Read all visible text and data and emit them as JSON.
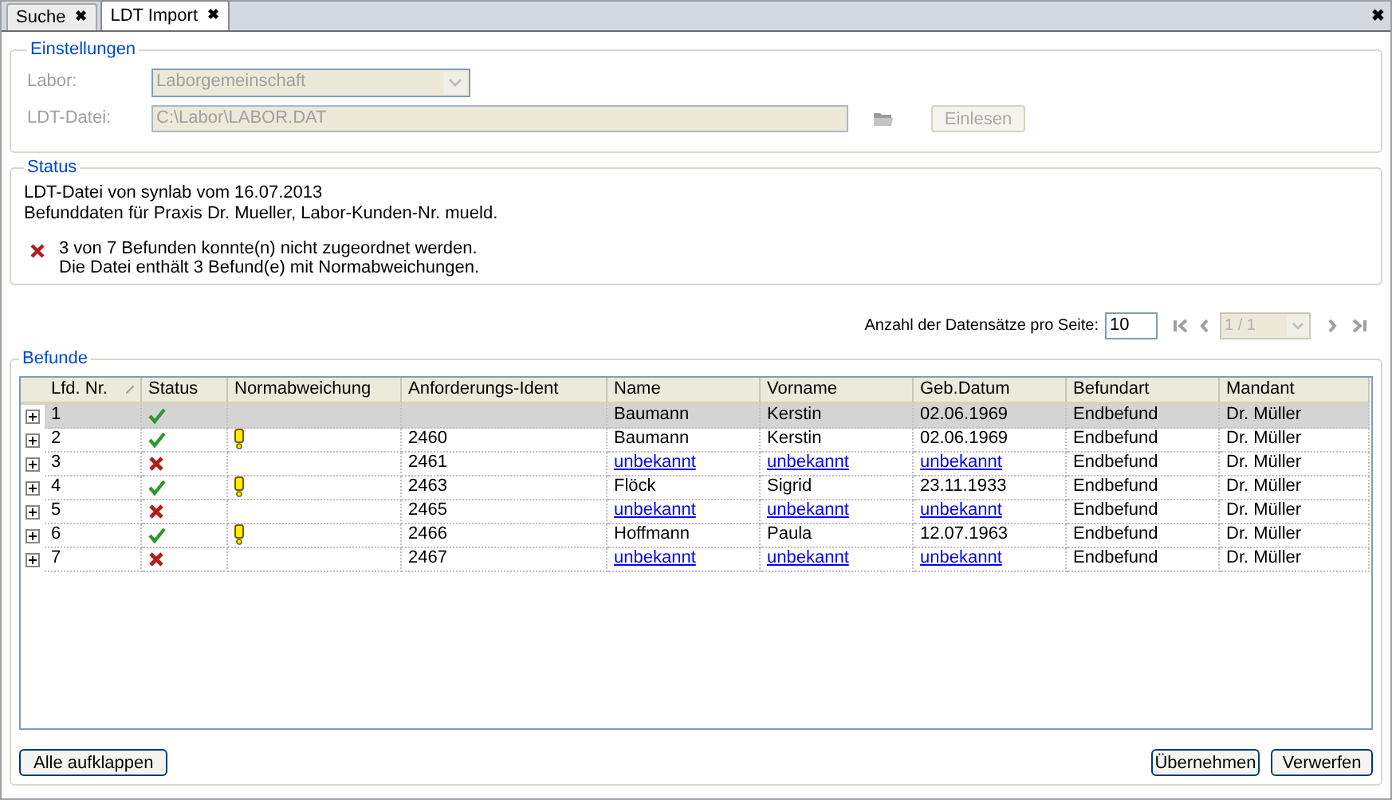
{
  "tabs": [
    {
      "label": "Suche",
      "selected": false,
      "close": "✖"
    },
    {
      "label": "LDT Import",
      "selected": true,
      "close": "✖"
    }
  ],
  "window_close": "✖",
  "einstellungen": {
    "title": "Einstellungen",
    "labor_label": "Labor:",
    "labor_value": "Laborgemeinschaft",
    "datei_label": "LDT-Datei:",
    "datei_value": "C:\\Labor\\LABOR.DAT",
    "read_button": "Einlesen"
  },
  "status": {
    "title": "Status",
    "lines": [
      "LDT-Datei von synlab vom 16.07.2013",
      "Befunddaten für Praxis Dr. Mueller, Labor-Kunden-Nr. mueld."
    ],
    "messages": [
      "3 von 7 Befunden konnte(n) nicht zugeordnet werden.",
      "Die Datei enthält 3 Befund(e) mit Normabweichungen."
    ]
  },
  "pager": {
    "label": "Anzahl der Datensätze pro Seite:",
    "page_size": "10",
    "page": "1 / 1"
  },
  "befunde": {
    "title": "Befunde",
    "columns": [
      "Lfd. Nr.",
      "Status",
      "Normabweichung",
      "Anforderungs-Ident",
      "Name",
      "Vorname",
      "Geb.Datum",
      "Befundart",
      "Mandant"
    ],
    "rows": [
      {
        "nr": "1",
        "assigned": true,
        "deviation": false,
        "ident": "",
        "name": "Baumann",
        "vorname": "Kerstin",
        "geb": "02.06.1969",
        "art": "Endbefund",
        "mandant": "Dr. Müller",
        "selected": true
      },
      {
        "nr": "2",
        "assigned": true,
        "deviation": true,
        "ident": "2460",
        "name": "Baumann",
        "vorname": "Kerstin",
        "geb": "02.06.1969",
        "art": "Endbefund",
        "mandant": "Dr. Müller",
        "selected": false
      },
      {
        "nr": "3",
        "assigned": false,
        "deviation": false,
        "ident": "2461",
        "name": "unbekannt",
        "vorname": "unbekannt",
        "geb": "unbekannt",
        "art": "Endbefund",
        "mandant": "Dr. Müller",
        "selected": false
      },
      {
        "nr": "4",
        "assigned": true,
        "deviation": true,
        "ident": "2463",
        "name": "Flöck",
        "vorname": "Sigrid",
        "geb": "23.11.1933",
        "art": "Endbefund",
        "mandant": "Dr. Müller",
        "selected": false
      },
      {
        "nr": "5",
        "assigned": false,
        "deviation": false,
        "ident": "2465",
        "name": "unbekannt",
        "vorname": "unbekannt",
        "geb": "unbekannt",
        "art": "Endbefund",
        "mandant": "Dr. Müller",
        "selected": false
      },
      {
        "nr": "6",
        "assigned": true,
        "deviation": true,
        "ident": "2466",
        "name": "Hoffmann",
        "vorname": "Paula",
        "geb": "12.07.1963",
        "art": "Endbefund",
        "mandant": "Dr. Müller",
        "selected": false
      },
      {
        "nr": "7",
        "assigned": false,
        "deviation": false,
        "ident": "2467",
        "name": "unbekannt",
        "vorname": "unbekannt",
        "geb": "unbekannt",
        "art": "Endbefund",
        "mandant": "Dr. Müller",
        "selected": false
      }
    ]
  },
  "buttons": {
    "expand_all": "Alle aufklappen",
    "accept": "Übernehmen",
    "discard": "Verwerfen"
  }
}
